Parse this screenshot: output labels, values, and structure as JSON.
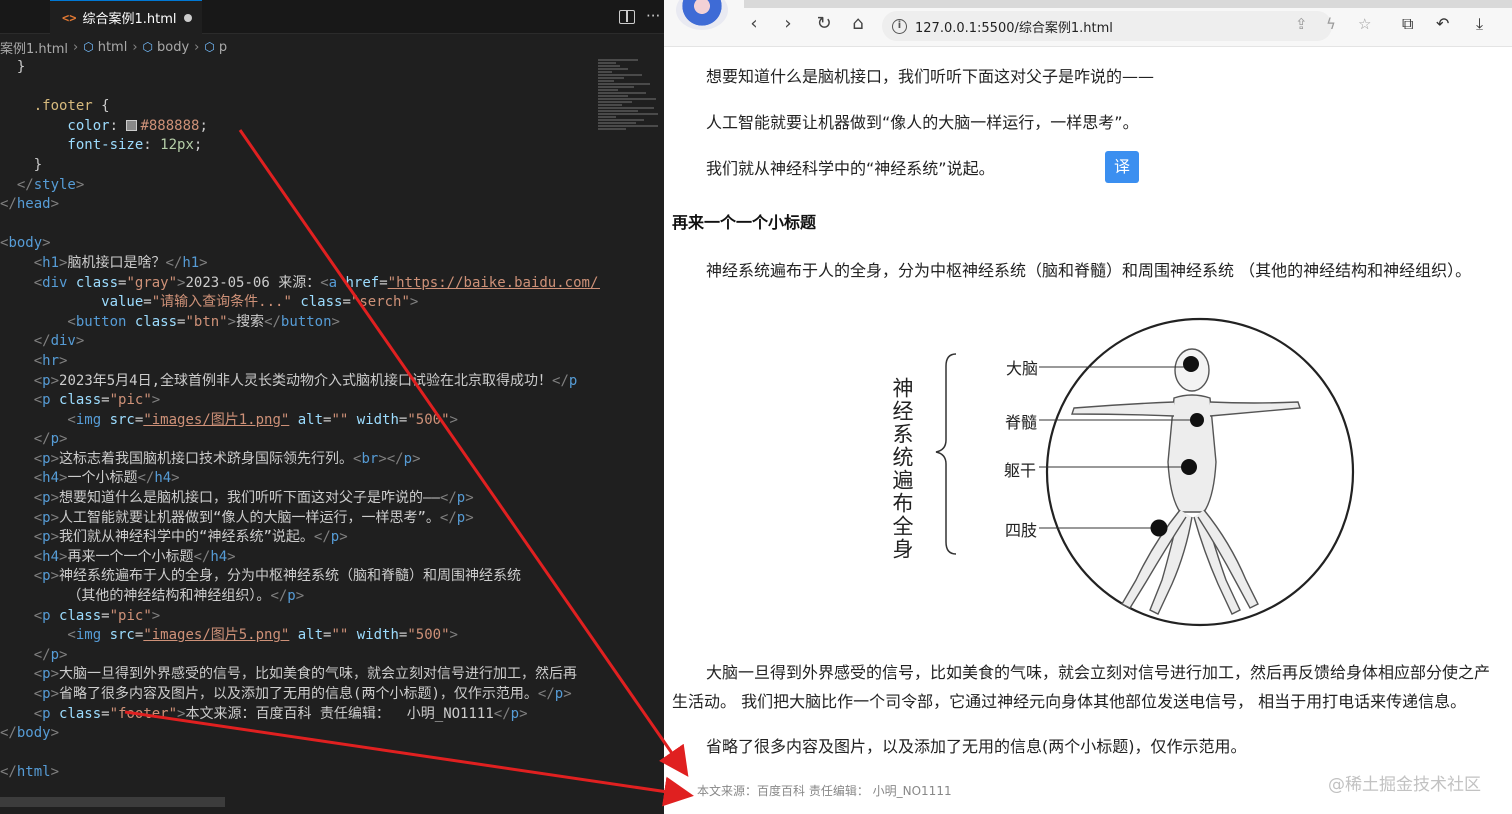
{
  "editor": {
    "tab_label": "综合案例1.html",
    "breadcrumb": [
      "案例1.html",
      "html",
      "body",
      "p"
    ],
    "code_lines": [
      [
        [
          "c-txt",
          "  }"
        ]
      ],
      [
        [
          "c-txt",
          ""
        ]
      ],
      [
        [
          "c-sel",
          "    .footer "
        ],
        [
          "c-txt",
          "{"
        ]
      ],
      [
        [
          "c-prop",
          "        color"
        ],
        [
          "c-txt",
          ": "
        ],
        [
          "swatch",
          ""
        ],
        [
          "c-str",
          "#888888"
        ],
        [
          "c-txt",
          ";"
        ]
      ],
      [
        [
          "c-prop",
          "        font-size"
        ],
        [
          "c-txt",
          ": "
        ],
        [
          "c-num",
          "12px"
        ],
        [
          "c-txt",
          ";"
        ]
      ],
      [
        [
          "c-txt",
          "    }"
        ]
      ],
      [
        [
          "c-brk",
          "  </"
        ],
        [
          "c-tag",
          "style"
        ],
        [
          "c-brk",
          ">"
        ]
      ],
      [
        [
          "c-brk",
          "</"
        ],
        [
          "c-tag",
          "head"
        ],
        [
          "c-brk",
          ">"
        ]
      ],
      [
        [
          "c-txt",
          ""
        ]
      ],
      [
        [
          "c-brk",
          "<"
        ],
        [
          "c-tag",
          "body"
        ],
        [
          "c-brk",
          ">"
        ]
      ],
      [
        [
          "c-brk",
          "    <"
        ],
        [
          "c-tag",
          "h1"
        ],
        [
          "c-brk",
          ">"
        ],
        [
          "c-txt",
          "脑机接口是啥？"
        ],
        [
          "c-brk",
          "</"
        ],
        [
          "c-tag",
          "h1"
        ],
        [
          "c-brk",
          ">"
        ]
      ],
      [
        [
          "c-brk",
          "    <"
        ],
        [
          "c-tag",
          "div "
        ],
        [
          "c-attr",
          "class"
        ],
        [
          "c-txt",
          "="
        ],
        [
          "c-str",
          "\"gray\""
        ],
        [
          "c-brk",
          ">"
        ],
        [
          "c-txt",
          "2023-05-06 来源："
        ],
        [
          "c-brk",
          "<"
        ],
        [
          "c-tag",
          "a "
        ],
        [
          "c-attr",
          "href"
        ],
        [
          "c-txt",
          "="
        ],
        [
          "c-str c-u",
          "\"https://baike.baidu.com/\""
        ],
        [
          "c-attr",
          " ta"
        ]
      ],
      [
        [
          "c-attr",
          "            value"
        ],
        [
          "c-txt",
          "="
        ],
        [
          "c-str",
          "\"请输入查询条件...\""
        ],
        [
          "c-attr",
          " class"
        ],
        [
          "c-txt",
          "="
        ],
        [
          "c-str",
          "\"serch\""
        ],
        [
          "c-brk",
          ">"
        ]
      ],
      [
        [
          "c-brk",
          "        <"
        ],
        [
          "c-tag",
          "button "
        ],
        [
          "c-attr",
          "class"
        ],
        [
          "c-txt",
          "="
        ],
        [
          "c-str",
          "\"btn\""
        ],
        [
          "c-brk",
          ">"
        ],
        [
          "c-txt",
          "搜索"
        ],
        [
          "c-brk",
          "</"
        ],
        [
          "c-tag",
          "button"
        ],
        [
          "c-brk",
          ">"
        ]
      ],
      [
        [
          "c-brk",
          "    </"
        ],
        [
          "c-tag",
          "div"
        ],
        [
          "c-brk",
          ">"
        ]
      ],
      [
        [
          "c-brk",
          "    <"
        ],
        [
          "c-tag",
          "hr"
        ],
        [
          "c-brk",
          ">"
        ]
      ],
      [
        [
          "c-brk",
          "    <"
        ],
        [
          "c-tag",
          "p"
        ],
        [
          "c-brk",
          ">"
        ],
        [
          "c-txt",
          "2023年5月4日,全球首例非人灵长类动物介入式脑机接口试验在北京取得成功！"
        ],
        [
          "c-brk",
          "</"
        ],
        [
          "c-tag",
          "p"
        ]
      ],
      [
        [
          "c-brk",
          "    <"
        ],
        [
          "c-tag",
          "p "
        ],
        [
          "c-attr",
          "class"
        ],
        [
          "c-txt",
          "="
        ],
        [
          "c-str",
          "\"pic\""
        ],
        [
          "c-brk",
          ">"
        ]
      ],
      [
        [
          "c-brk",
          "        <"
        ],
        [
          "c-tag",
          "img "
        ],
        [
          "c-attr",
          "src"
        ],
        [
          "c-txt",
          "="
        ],
        [
          "c-str c-u",
          "\"images/图片1.png\""
        ],
        [
          "c-attr",
          " alt"
        ],
        [
          "c-txt",
          "="
        ],
        [
          "c-str",
          "\"\""
        ],
        [
          "c-attr",
          " width"
        ],
        [
          "c-txt",
          "="
        ],
        [
          "c-str",
          "\"500\""
        ],
        [
          "c-brk",
          ">"
        ]
      ],
      [
        [
          "c-brk",
          "    </"
        ],
        [
          "c-tag",
          "p"
        ],
        [
          "c-brk",
          ">"
        ]
      ],
      [
        [
          "c-brk",
          "    <"
        ],
        [
          "c-tag",
          "p"
        ],
        [
          "c-brk",
          ">"
        ],
        [
          "c-txt",
          "这标志着我国脑机接口技术跻身国际领先行列。"
        ],
        [
          "c-brk",
          "<"
        ],
        [
          "c-tag",
          "br"
        ],
        [
          "c-brk",
          "></"
        ],
        [
          "c-tag",
          "p"
        ],
        [
          "c-brk",
          ">"
        ]
      ],
      [
        [
          "c-brk",
          "    <"
        ],
        [
          "c-tag",
          "h4"
        ],
        [
          "c-brk",
          ">"
        ],
        [
          "c-txt",
          "一个小标题"
        ],
        [
          "c-brk",
          "</"
        ],
        [
          "c-tag",
          "h4"
        ],
        [
          "c-brk",
          ">"
        ]
      ],
      [
        [
          "c-brk",
          "    <"
        ],
        [
          "c-tag",
          "p"
        ],
        [
          "c-brk",
          ">"
        ],
        [
          "c-txt",
          "想要知道什么是脑机接口，我们听听下面这对父子是咋说的——"
        ],
        [
          "c-brk",
          "</"
        ],
        [
          "c-tag",
          "p"
        ],
        [
          "c-brk",
          ">"
        ]
      ],
      [
        [
          "c-brk",
          "    <"
        ],
        [
          "c-tag",
          "p"
        ],
        [
          "c-brk",
          ">"
        ],
        [
          "c-txt",
          "人工智能就要让机器做到“像人的大脑一样运行，一样思考”。"
        ],
        [
          "c-brk",
          "</"
        ],
        [
          "c-tag",
          "p"
        ],
        [
          "c-brk",
          ">"
        ]
      ],
      [
        [
          "c-brk",
          "    <"
        ],
        [
          "c-tag",
          "p"
        ],
        [
          "c-brk",
          ">"
        ],
        [
          "c-txt",
          "我们就从神经科学中的“神经系统”说起。"
        ],
        [
          "c-brk",
          "</"
        ],
        [
          "c-tag",
          "p"
        ],
        [
          "c-brk",
          ">"
        ]
      ],
      [
        [
          "c-brk",
          "    <"
        ],
        [
          "c-tag",
          "h4"
        ],
        [
          "c-brk",
          ">"
        ],
        [
          "c-txt",
          "再来一个一个小标题"
        ],
        [
          "c-brk",
          "</"
        ],
        [
          "c-tag",
          "h4"
        ],
        [
          "c-brk",
          ">"
        ]
      ],
      [
        [
          "c-brk",
          "    <"
        ],
        [
          "c-tag",
          "p"
        ],
        [
          "c-brk",
          ">"
        ],
        [
          "c-txt",
          "神经系统遍布于人的全身，分为中枢神经系统（脑和脊髓）和周围神经系统"
        ]
      ],
      [
        [
          "c-txt",
          "        （其他的神经结构和神经组织）。"
        ],
        [
          "c-brk",
          "</"
        ],
        [
          "c-tag",
          "p"
        ],
        [
          "c-brk",
          ">"
        ]
      ],
      [
        [
          "c-brk",
          "    <"
        ],
        [
          "c-tag",
          "p "
        ],
        [
          "c-attr",
          "class"
        ],
        [
          "c-txt",
          "="
        ],
        [
          "c-str",
          "\"pic\""
        ],
        [
          "c-brk",
          ">"
        ]
      ],
      [
        [
          "c-brk",
          "        <"
        ],
        [
          "c-tag",
          "img "
        ],
        [
          "c-attr",
          "src"
        ],
        [
          "c-txt",
          "="
        ],
        [
          "c-str c-u",
          "\"images/图片5.png\""
        ],
        [
          "c-attr",
          " alt"
        ],
        [
          "c-txt",
          "="
        ],
        [
          "c-str",
          "\"\""
        ],
        [
          "c-attr",
          " width"
        ],
        [
          "c-txt",
          "="
        ],
        [
          "c-str",
          "\"500\""
        ],
        [
          "c-brk",
          ">"
        ]
      ],
      [
        [
          "c-brk",
          "    </"
        ],
        [
          "c-tag",
          "p"
        ],
        [
          "c-brk",
          ">"
        ]
      ],
      [
        [
          "c-brk",
          "    <"
        ],
        [
          "c-tag",
          "p"
        ],
        [
          "c-brk",
          ">"
        ],
        [
          "c-txt",
          "大脑一旦得到外界感受的信号，比如美食的气味，就会立刻对信号进行加工，然后再"
        ]
      ],
      [
        [
          "c-brk",
          "    <"
        ],
        [
          "c-tag",
          "p"
        ],
        [
          "c-brk",
          ">"
        ],
        [
          "c-txt",
          "省略了很多内容及图片，以及添加了无用的信息(两个小标题)，仅作示范用。"
        ],
        [
          "c-brk",
          "</"
        ],
        [
          "c-tag",
          "p"
        ],
        [
          "c-brk",
          ">"
        ]
      ],
      [
        [
          "c-brk",
          "    <"
        ],
        [
          "c-tag",
          "p "
        ],
        [
          "c-attr",
          "class"
        ],
        [
          "c-txt",
          "="
        ],
        [
          "c-str",
          "\"footer\""
        ],
        [
          "c-brk",
          ">"
        ],
        [
          "c-txt",
          "本文来源：百度百科 责任编辑：  小明_NO1111"
        ],
        [
          "c-brk",
          "</"
        ],
        [
          "c-tag",
          "p"
        ],
        [
          "c-brk",
          ">"
        ]
      ],
      [
        [
          "c-brk",
          "</"
        ],
        [
          "c-tag",
          "body"
        ],
        [
          "c-brk",
          ">"
        ]
      ],
      [
        [
          "c-txt",
          ""
        ]
      ],
      [
        [
          "c-brk",
          "</"
        ],
        [
          "c-tag",
          "html"
        ],
        [
          "c-brk",
          ">"
        ]
      ]
    ]
  },
  "browser": {
    "url": "127.0.0.1:5500/综合案例1.html",
    "p1": "想要知道什么是脑机接口，我们听听下面这对父子是咋说的——",
    "p2": "人工智能就要让机器做到“像人的大脑一样运行，一样思考”。",
    "p3": "我们就从神经科学中的“神经系统”说起。",
    "translate_label": "译",
    "h4": "再来一个一个小标题",
    "p4": "神经系统遍布于人的全身，分为中枢神经系统（脑和脊髓）和周围神经系统 （其他的神经结构和神经组织）。",
    "figure_title": "神经系统遍布全身",
    "figure_labels": [
      "大脑",
      "脊髓",
      "躯干",
      "四肢"
    ],
    "p5_line1": "大脑一旦得到外界感受的信号，比如美食的气味，就会立刻对信号进行加工，然后再反馈给身体相应部分使之产",
    "p5_line2": "生活动。 我们把大脑比作一个司令部，它通过神经元向身体其他部位发送电信号， 相当于用打电话来传递信息。",
    "p6": "省略了很多内容及图片，以及添加了无用的信息(两个小标题)，仅作示范用。",
    "footer": "本文来源：百度百科 责任编辑：  小明_NO1111",
    "watermark": "@稀土掘金技术社区"
  },
  "colors": {
    "footer_text": "#888888",
    "arrow": "#e02020",
    "translate_button": "#3b8ff0"
  }
}
